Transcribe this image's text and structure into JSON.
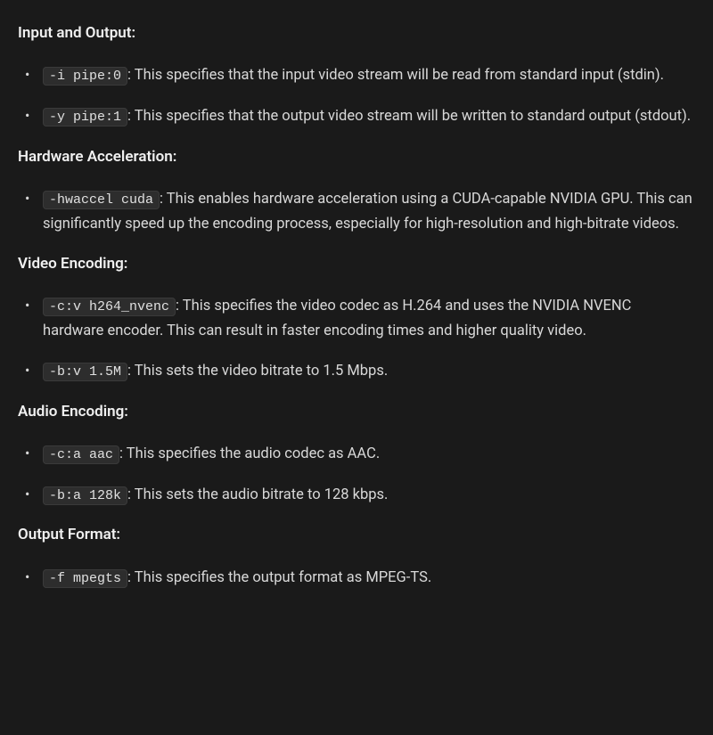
{
  "sections": [
    {
      "heading": "Input and Output:",
      "items": [
        {
          "code": "-i pipe:0",
          "text": ": This specifies that the input video stream will be read from standard input (stdin)."
        },
        {
          "code": "-y pipe:1",
          "text": ": This specifies that the output video stream will be written to standard output (stdout)."
        }
      ]
    },
    {
      "heading": "Hardware Acceleration:",
      "items": [
        {
          "code": "-hwaccel cuda",
          "text": ": This enables hardware acceleration using a CUDA-capable NVIDIA GPU. This can significantly speed up the encoding process, especially for high-resolution and high-bitrate videos."
        }
      ]
    },
    {
      "heading": "Video Encoding:",
      "items": [
        {
          "code": "-c:v h264_nvenc",
          "text": ": This specifies the video codec as H.264 and uses the NVIDIA NVENC hardware encoder. This can result in faster encoding times and higher quality video."
        },
        {
          "code": "-b:v 1.5M",
          "text": ": This sets the video bitrate to 1.5 Mbps."
        }
      ]
    },
    {
      "heading": "Audio Encoding:",
      "items": [
        {
          "code": "-c:a aac",
          "text": ": This specifies the audio codec as AAC."
        },
        {
          "code": "-b:a 128k",
          "text": ": This sets the audio bitrate to 128 kbps."
        }
      ]
    },
    {
      "heading": "Output Format:",
      "items": [
        {
          "code": "-f mpegts",
          "text": ": This specifies the output format as MPEG-TS."
        }
      ]
    }
  ]
}
